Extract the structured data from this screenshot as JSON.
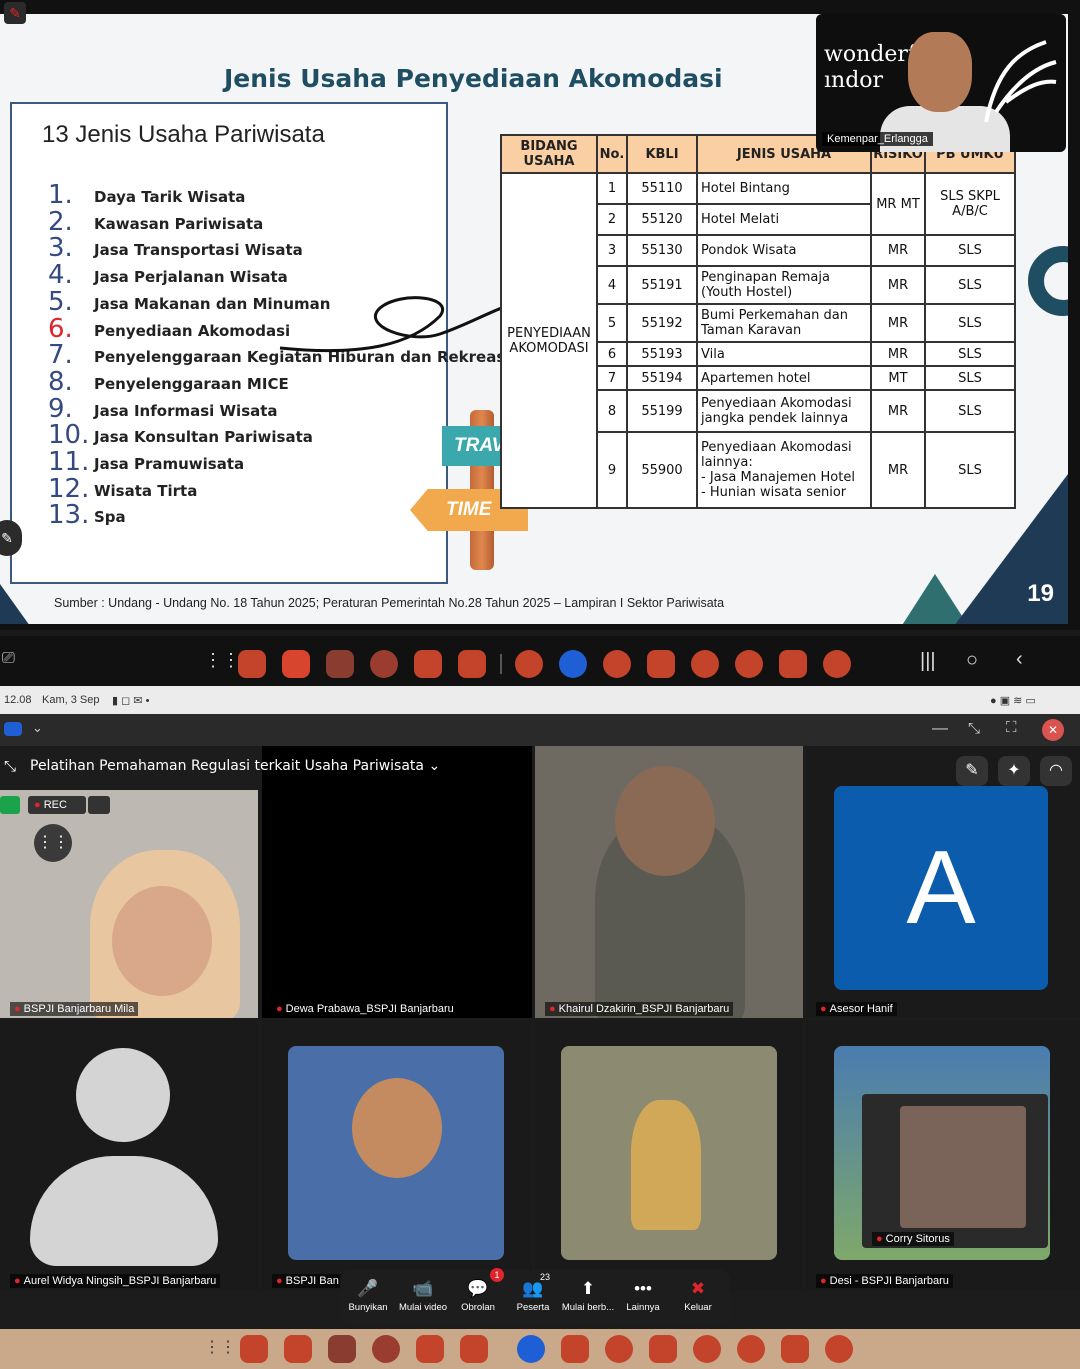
{
  "slide": {
    "title": "Jenis Usaha Penyediaan Akomodasi",
    "list_heading": "13 Jenis Usaha Pariwisata",
    "list": [
      {
        "num": "1.",
        "text": "Daya Tarik Wisata"
      },
      {
        "num": "2.",
        "text": "Kawasan Pariwisata"
      },
      {
        "num": "3.",
        "text": "Jasa Transportasi Wisata"
      },
      {
        "num": "4.",
        "text": "Jasa Perjalanan Wisata"
      },
      {
        "num": "5.",
        "text": "Jasa Makanan dan Minuman"
      },
      {
        "num": "6.",
        "text": "Penyediaan Akomodasi",
        "highlight": true
      },
      {
        "num": "7.",
        "text": "Penyelenggaraan Kegiatan Hiburan dan Rekreasi"
      },
      {
        "num": "8.",
        "text": "Penyelenggaraan MICE"
      },
      {
        "num": "9.",
        "text": "Jasa Informasi Wisata"
      },
      {
        "num": "10.",
        "text": "Jasa Konsultan Pariwisata"
      },
      {
        "num": "11.",
        "text": "Jasa Pramuwisata"
      },
      {
        "num": "12.",
        "text": "Wisata Tirta"
      },
      {
        "num": "13.",
        "text": "Spa"
      }
    ],
    "sign_travel": "TRAVEL",
    "sign_time": "TIME",
    "table": {
      "headers": [
        "BIDANG USAHA",
        "No.",
        "KBLI",
        "JENIS USAHA",
        "RISIKO",
        "PB UMKU"
      ],
      "bidang": "PENYEDIAAN AKOMODASI",
      "rows": [
        {
          "no": "1",
          "kbli": "55110",
          "jenis": "Hotel Bintang"
        },
        {
          "no": "2",
          "kbli": "55120",
          "jenis": "Hotel Melati"
        },
        {
          "no": "3",
          "kbli": "55130",
          "jenis": "Pondok Wisata",
          "risiko": "MR",
          "pb": "SLS"
        },
        {
          "no": "4",
          "kbli": "55191",
          "jenis": "Penginapan Remaja (Youth Hostel)",
          "risiko": "MR",
          "pb": "SLS"
        },
        {
          "no": "5",
          "kbli": "55192",
          "jenis": "Bumi Perkemahan dan Taman Karavan",
          "risiko": "MR",
          "pb": "SLS"
        },
        {
          "no": "6",
          "kbli": "55193",
          "jenis": "Vila",
          "risiko": "MR",
          "pb": "SLS"
        },
        {
          "no": "7",
          "kbli": "55194",
          "jenis": "Apartemen hotel",
          "risiko": "MT",
          "pb": "SLS"
        },
        {
          "no": "8",
          "kbli": "55199",
          "jenis": "Penyediaan Akomodasi jangka pendek lainnya",
          "risiko": "MR",
          "pb": "SLS"
        },
        {
          "no": "9",
          "kbli": "55900",
          "jenis_lines": [
            "Penyediaan Akomodasi lainnya:",
            "- Jasa Manajemen Hotel",
            "- Hunian wisata senior"
          ],
          "risiko": "MR",
          "pb": "SLS"
        }
      ],
      "merged_risiko_1_2": "MR MT",
      "merged_pb_1_2": "SLS SKPL A/B/C"
    },
    "source": "Sumber : Undang - Undang No. 18 Tahun 2025; Peraturan Pemerintah No.28 Tahun 2025 – Lampiran I Sektor Pariwisata",
    "page_number": "19"
  },
  "speaker": {
    "logo": "wonderf\nındor",
    "name": "Kemenpar_Erlangga"
  },
  "status": {
    "time": "12.08",
    "date": "Kam, 3 Sep"
  },
  "zoom": {
    "meeting_title": "Pelatihan Pemahaman Regulasi terkait Usaha Pariwisata",
    "rec": "REC",
    "tiles": [
      {
        "name": "BSPJI Banjarbaru Mila"
      },
      {
        "name": "Dewa Prabawa_BSPJI Banjarbaru"
      },
      {
        "name": "Khairul Dzakirin_BSPJI Banjarbaru"
      },
      {
        "name": "Asesor Hanif",
        "initial": "A"
      },
      {
        "name": "Aurel Widya Ningsih_BSPJI Banjarbaru"
      },
      {
        "name": "BSPJI Ban"
      },
      {
        "name": ""
      },
      {
        "name": "Desi - BSPJI Banjarbaru"
      }
    ],
    "pip_name": "Corry Sitorus",
    "toolbar": [
      {
        "label": "Bunyikan",
        "icon": "🎤"
      },
      {
        "label": "Mulai video",
        "icon": "📹"
      },
      {
        "label": "Obrolan",
        "icon": "💬",
        "badge": "1"
      },
      {
        "label": "Peserta",
        "icon": "👥",
        "count": "23"
      },
      {
        "label": "Mulai berb...",
        "icon": "⬆"
      },
      {
        "label": "Lainnya",
        "icon": "•••"
      },
      {
        "label": "Keluar",
        "icon": "✖"
      }
    ]
  },
  "colors": {
    "title": "#1f4e63",
    "list_num": "#364a82",
    "highlight_num": "#e0242c",
    "table_header": "#f9cfa3",
    "avatar_a": "#0b5cad",
    "rec": "#e0242c"
  }
}
